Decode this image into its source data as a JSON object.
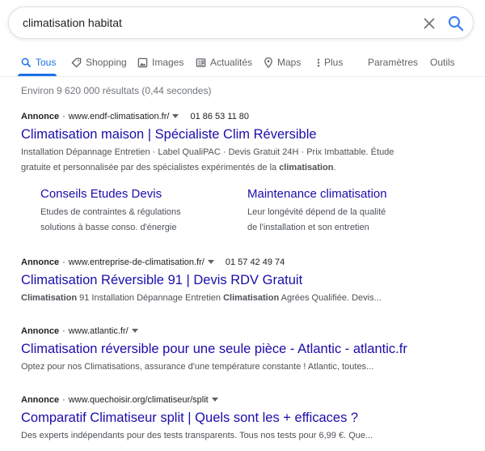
{
  "search": {
    "query": "climatisation habitat"
  },
  "tabs": [
    {
      "label": "Tous",
      "icon": "search-icon"
    },
    {
      "label": "Shopping",
      "icon": "tag-icon"
    },
    {
      "label": "Images",
      "icon": "image-icon"
    },
    {
      "label": "Actualités",
      "icon": "news-icon"
    },
    {
      "label": "Maps",
      "icon": "map-pin-icon"
    },
    {
      "label": "Plus",
      "icon": "more-dots-icon"
    },
    {
      "label": "Paramètres"
    },
    {
      "label": "Outils"
    }
  ],
  "result_stats": "Environ 9 620 000 résultats (0,44 secondes)",
  "ads": [
    {
      "label": "Annonce",
      "separator": "·",
      "url": "www.endf-climatisation.fr/",
      "phone": "01 86 53 11 80",
      "title": "Climatisation maison | Spécialiste Clim Réversible",
      "desc_line1": "Installation Dépannage Entretien · Label QualiPAC · Devis Gratuit 24H · Prix Imbattable. Étude",
      "desc_line2_pre": "gratuite et personnalisée par des spécialistes expérimentés de la ",
      "desc_line2_bold": "climatisation",
      "desc_line2_post": ".",
      "sitelinks": [
        {
          "title": "Conseils Etudes Devis",
          "desc_line1": "Etudes de contraintes & régulations",
          "desc_line2": "solutions à basse conso. d'énergie"
        },
        {
          "title": "Maintenance climatisation",
          "desc_line1": "Leur longévité dépend de la qualité",
          "desc_line2": "de l'installation et son entretien"
        }
      ]
    },
    {
      "label": "Annonce",
      "separator": "·",
      "url": "www.entreprise-de-climatisation.fr/",
      "phone": "01 57 42 49 74",
      "title": "Climatisation Réversible 91 | Devis RDV Gratuit",
      "desc_bold1": "Climatisation",
      "desc_mid": " 91 Installation Dépannage Entretien ",
      "desc_bold2": "Climatisation",
      "desc_post": " Agrées Qualifiée. Devis..."
    },
    {
      "label": "Annonce",
      "separator": "·",
      "url": "www.atlantic.fr/",
      "title": "Climatisation réversible pour une seule pièce - Atlantic - atlantic.fr",
      "desc": "Optez pour nos Climatisations, assurance d'une température constante ! Atlantic, toutes..."
    },
    {
      "label": "Annonce",
      "separator": "·",
      "url": "www.quechoisir.org/climatiseur/split",
      "title": "Comparatif Climatiseur split | Quels sont les + efficaces ?",
      "desc": "Des experts indépendants pour des tests transparents. Tous nos tests pour 6,99 €. Que..."
    }
  ],
  "colors": {
    "link": "#1a0dab",
    "accent": "#1a73e8",
    "muted": "#70757a",
    "text": "#4d5156"
  }
}
